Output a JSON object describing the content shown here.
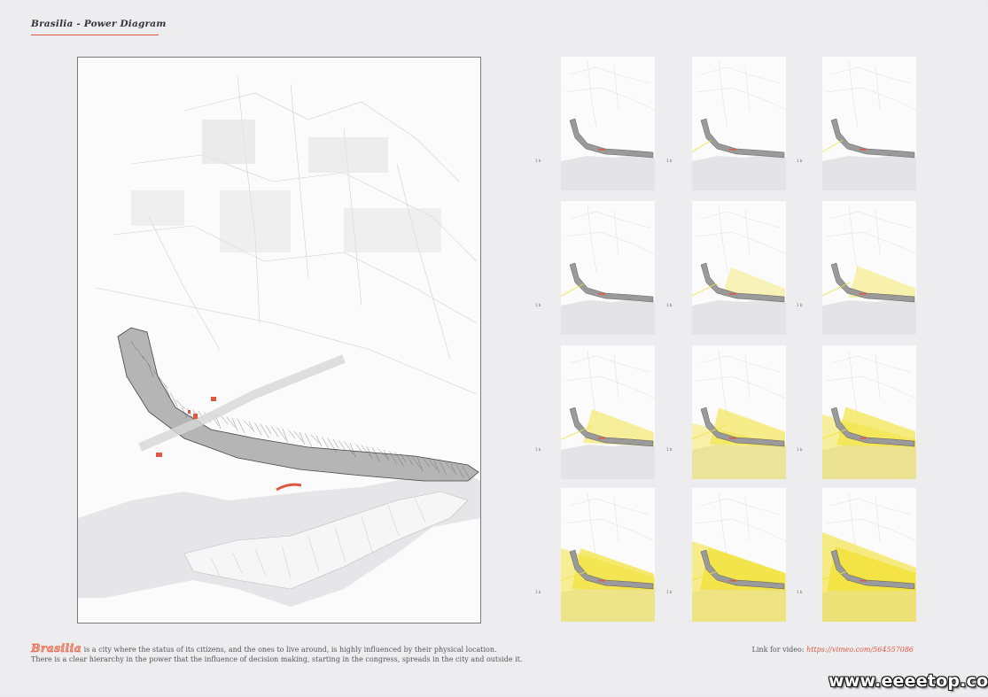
{
  "poster": {
    "title": "Brasilia - Power Diagram",
    "accent_color": "#e0573f",
    "highlight_color": "#f3e23a"
  },
  "main_map": {
    "highlight_color": "#e0573f",
    "description": "Aerial axonometric map of Brasilia with highlighted buildings"
  },
  "sequence": {
    "frames": [
      {
        "index": 1,
        "tag": "1 b",
        "influence_level": 0.0
      },
      {
        "index": 2,
        "tag": "1 b",
        "influence_level": 0.05
      },
      {
        "index": 3,
        "tag": "1 b",
        "influence_level": 0.1
      },
      {
        "index": 4,
        "tag": "1 b",
        "influence_level": 0.18
      },
      {
        "index": 5,
        "tag": "1 b",
        "influence_level": 0.28
      },
      {
        "index": 6,
        "tag": "1 b",
        "influence_level": 0.38
      },
      {
        "index": 7,
        "tag": "1 b",
        "influence_level": 0.5
      },
      {
        "index": 8,
        "tag": "1 b",
        "influence_level": 0.62
      },
      {
        "index": 9,
        "tag": "1 b",
        "influence_level": 0.72
      },
      {
        "index": 10,
        "tag": "1 b",
        "influence_level": 0.82
      },
      {
        "index": 11,
        "tag": "1 b",
        "influence_level": 0.9
      },
      {
        "index": 12,
        "tag": "1 b",
        "influence_level": 1.0
      }
    ]
  },
  "description": {
    "city": "Brasilia",
    "line1": " is a city where the status of its citizens, and the ones to live around, is highly influenced by their physical location.",
    "line2": "There is a clear hierarchy in the power that the influence of decision making, starting in the congress, spreads in the city and outside it."
  },
  "video": {
    "label": "Link for video: ",
    "url": "https://vimeo.com/564557086"
  },
  "watermark": "www.eeeetop.com"
}
